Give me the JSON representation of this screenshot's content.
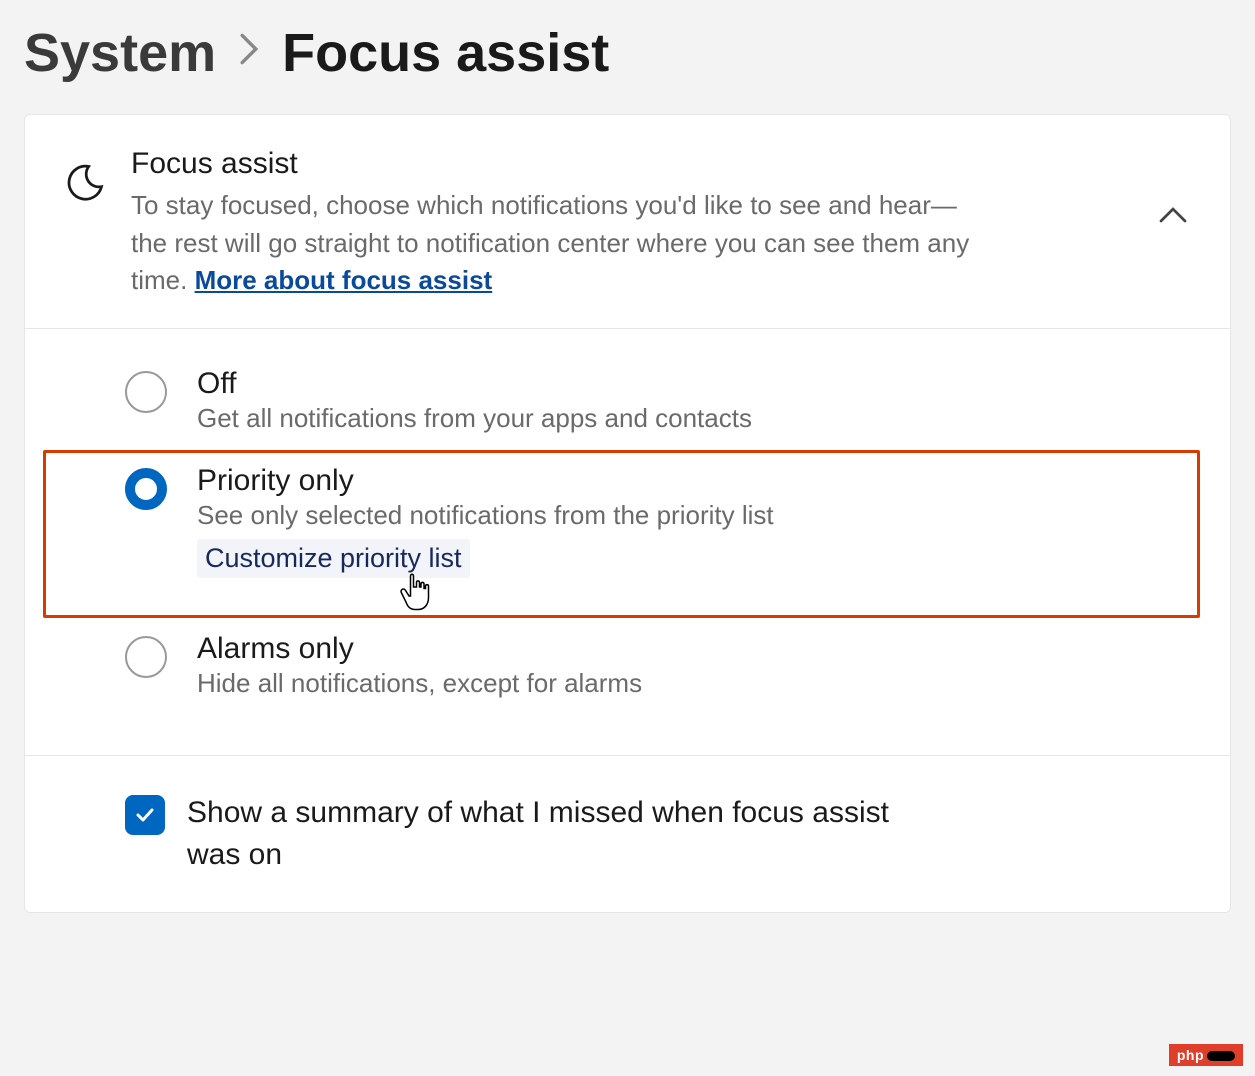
{
  "breadcrumb": {
    "parent": "System",
    "current": "Focus assist"
  },
  "header": {
    "title": "Focus assist",
    "description_pre": "To stay focused, choose which notifications you'd like to see and hear—the rest will go straight to notification center where you can see them any time.  ",
    "link_text": "More about focus assist"
  },
  "options": [
    {
      "title": "Off",
      "desc": "Get all notifications from your apps and contacts",
      "selected": false,
      "sublink": null
    },
    {
      "title": "Priority only",
      "desc": "See only selected notifications from the priority list",
      "selected": true,
      "sublink": "Customize priority list"
    },
    {
      "title": "Alarms only",
      "desc": "Hide all notifications, except for alarms",
      "selected": false,
      "sublink": null
    }
  ],
  "checkbox": {
    "label": "Show a summary of what I missed when focus assist was on",
    "checked": true
  },
  "watermark": "php"
}
